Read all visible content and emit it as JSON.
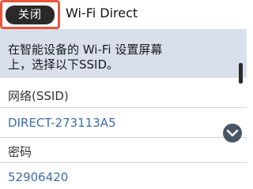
{
  "header": {
    "close_label": "关闭",
    "title": "Wi-Fi Direct"
  },
  "instruction": {
    "line1": "在智能设备的 Wi-Fi 设置屏幕",
    "line2": "上，选择以下SSID。"
  },
  "fields": {
    "network_label": "网络(SSID)",
    "network_value": "DIRECT-273113A5",
    "password_label": "密码",
    "password_value": "52906420"
  },
  "colors": {
    "accent": "#e8563c",
    "value_text": "#3b6cb0",
    "instruction_bg": "#d8e0ec"
  },
  "icons": {
    "scroll_down": "chevron-down-icon"
  }
}
